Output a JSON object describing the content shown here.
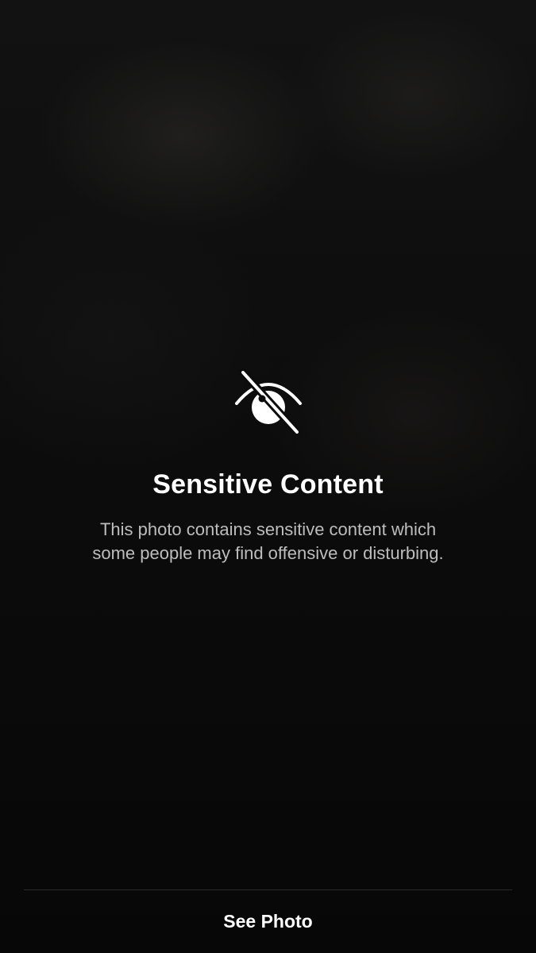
{
  "warning": {
    "icon": "eye-slash-icon",
    "title": "Sensitive Content",
    "description": "This photo contains sensitive content which some people may find offensive or disturbing."
  },
  "action": {
    "see_photo_label": "See Photo"
  },
  "colors": {
    "background": "#0b0b0b",
    "text_primary": "#ffffff",
    "text_secondary": "#bdbdbd",
    "divider": "#2a2a2a"
  }
}
